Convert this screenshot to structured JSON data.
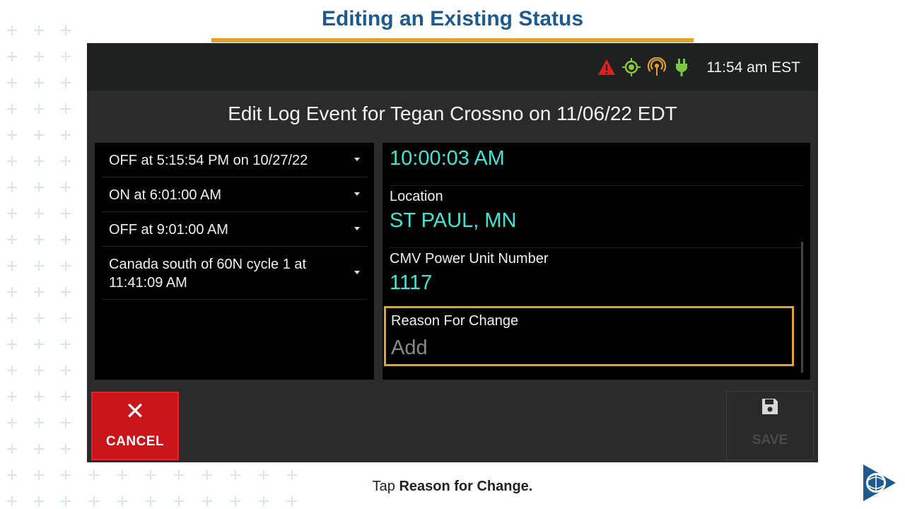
{
  "headline": "Editing an Existing Status",
  "status_bar": {
    "time": "11:54 am EST",
    "icons": [
      "warning-icon",
      "gps-icon",
      "signal-icon",
      "power-plug-icon"
    ]
  },
  "dialog": {
    "title": "Edit Log Event for Tegan Crossno on 11/06/22 EDT"
  },
  "events": [
    {
      "label": "OFF at 5:15:54 PM on 10/27/22"
    },
    {
      "label": "ON at 6:01:00 AM"
    },
    {
      "label": "OFF at 9:01:00 AM"
    },
    {
      "label": "Canada south of 60N cycle 1 at 11:41:09 AM"
    }
  ],
  "detail": {
    "time_value": "10:00:03 AM",
    "location_label": "Location",
    "location_value": "ST PAUL, MN",
    "cmv_label": "CMV Power Unit Number",
    "cmv_value": "1117",
    "reason_label": "Reason For Change",
    "reason_placeholder": "Add"
  },
  "buttons": {
    "cancel": "CANCEL",
    "save": "SAVE"
  },
  "caption": {
    "prefix": "Tap ",
    "emphasis": "Reason for Change."
  },
  "colors": {
    "accent": "#e3a12f",
    "title_blue": "#1d5b8f",
    "value_cyan": "#3fe6d4",
    "cancel_red": "#c9141a",
    "warning": "#e02020",
    "gps_green": "#8cc63f",
    "plug_green": "#7ac943"
  }
}
